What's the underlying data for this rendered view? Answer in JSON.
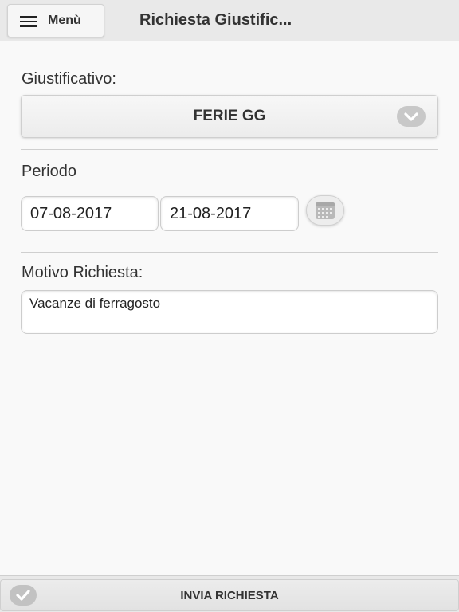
{
  "header": {
    "menu_label": "Menù",
    "title": "Richiesta Giustific..."
  },
  "form": {
    "justification": {
      "label": "Giustificativo:",
      "selected": "FERIE GG"
    },
    "period": {
      "label": "Periodo",
      "from": "07-08-2017",
      "to": "21-08-2017"
    },
    "reason": {
      "label": "Motivo Richiesta:",
      "value": "Vacanze di ferragosto"
    }
  },
  "footer": {
    "submit_label": "INVIA RICHIESTA"
  },
  "colors": {
    "background": "#f9f9f9",
    "header": "#e9e9e9",
    "icon_gray": "#c8c8c8"
  },
  "icons": {
    "menu": "hamburger-icon",
    "select": "chevron-down-icon",
    "calendar": "calendar-icon",
    "submit": "check-icon"
  }
}
